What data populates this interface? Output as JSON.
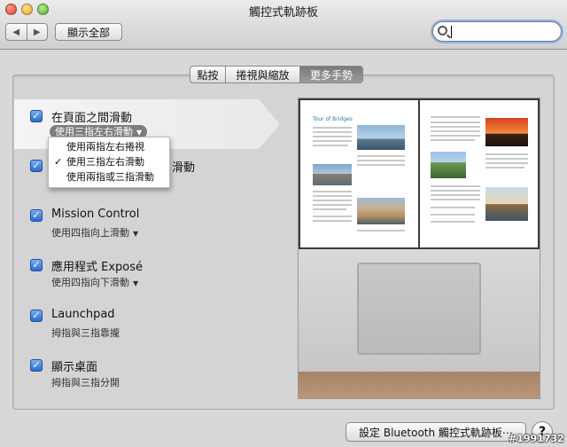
{
  "window": {
    "title": "觸控式軌跡板",
    "nav_back": "◀",
    "nav_forward": "▶",
    "show_all": "顯示全部",
    "search_value": ""
  },
  "tabs": [
    {
      "label": "點按",
      "active": false
    },
    {
      "label": "捲視與縮放",
      "active": false
    },
    {
      "label": "更多手勢",
      "active": true
    }
  ],
  "options": {
    "swipe_pages": {
      "title": "在頁面之間滑動",
      "setting": "使用三指左右滑動",
      "checked": true
    },
    "fullscreen_tail": "滑動",
    "mission_control": {
      "title": "Mission Control",
      "setting": "使用四指向上滑動",
      "checked": true
    },
    "app_expose": {
      "title": "應用程式 Exposé",
      "setting": "使用四指向下滑動",
      "checked": true
    },
    "launchpad": {
      "title": "Launchpad",
      "setting": "拇指與三指靠攏",
      "checked": true
    },
    "show_desktop": {
      "title": "顯示桌面",
      "setting": "拇指與三指分開",
      "checked": true
    }
  },
  "dropdown_menu": {
    "items": [
      {
        "label": "使用兩指左右捲視",
        "selected": false
      },
      {
        "label": "使用三指左右滑動",
        "selected": true
      },
      {
        "label": "使用兩指或三指滑動",
        "selected": false
      }
    ]
  },
  "checkmark": "✓",
  "menu_checkmark": "✓",
  "arrow": "▼",
  "preview": {
    "book_title": "Tour of Bridges"
  },
  "bottom": {
    "bluetooth_button": "設定 Bluetooth 觸控式軌跡板⋯",
    "help": "?"
  },
  "watermark": "#1991732"
}
